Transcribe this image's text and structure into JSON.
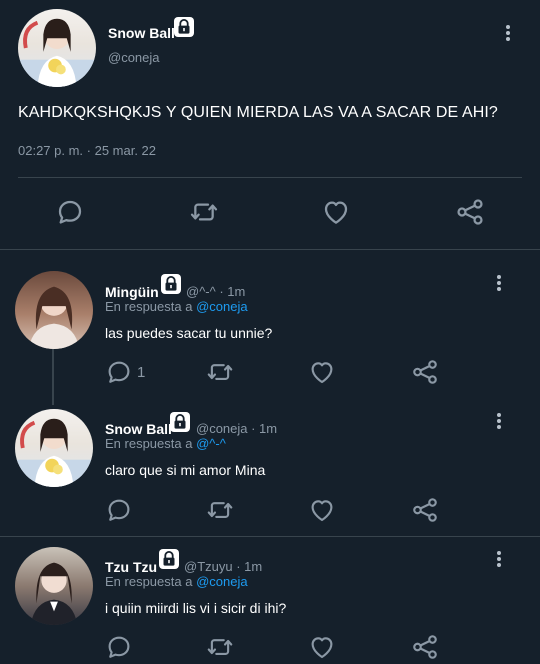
{
  "main": {
    "name": "Snow Ball",
    "handle": "@coneja",
    "text": "KAHDKQKSHQKJS Y QUIEN MIERDA LAS VA A SACAR DE AHI?",
    "meta": "02:27 p. m. · 25 mar. 22"
  },
  "replies": [
    {
      "name": "Mingüin",
      "handle_time": "@^-^ · 1m",
      "reply_prefix": "En respuesta a",
      "reply_to": "@coneja",
      "text": "las puedes sacar tu unnie?",
      "reply_count": "1"
    },
    {
      "name": "Snow Ball",
      "handle_time": "@coneja · 1m",
      "reply_prefix": "En respuesta a",
      "reply_to": "@^-^",
      "text": "claro que si mi amor Mina",
      "reply_count": ""
    },
    {
      "name": "Tzu Tzu",
      "handle_time": "@Tzuyu · 1m",
      "reply_prefix": "En respuesta a",
      "reply_to": "@coneja",
      "text": "i quiin miirdi lis vi i sicir di ihi?",
      "reply_count": ""
    }
  ],
  "icons": {
    "reply": "speech-bubble-icon",
    "retweet": "retweet-icon",
    "like": "heart-icon",
    "share": "share-icon",
    "lock": "lock-icon",
    "more": "more-vertical-icon"
  },
  "colors": {
    "background": "#15202b",
    "divider": "#38444d",
    "text": "#ffffff",
    "muted": "#8b98a5",
    "link": "#1d9bf0",
    "icon": "#8b98a5"
  }
}
